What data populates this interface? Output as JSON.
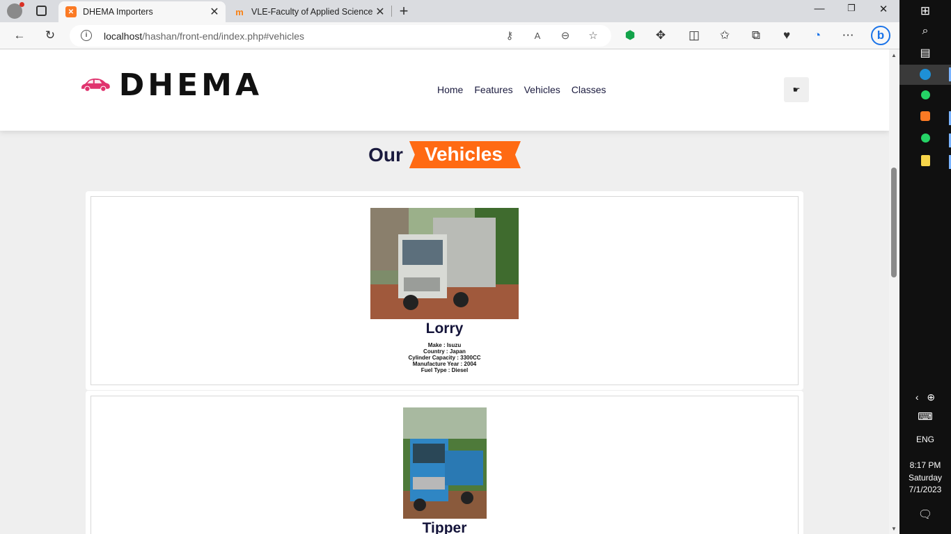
{
  "browser": {
    "tabs": [
      {
        "title": "DHEMA Importers",
        "favicon": "xampp-icon",
        "active": true
      },
      {
        "title": "VLE-Faculty of Applied Science: L",
        "favicon": "moodle-icon",
        "active": false
      }
    ],
    "url_host": "localhost",
    "url_path": "/hashan/front-end/index.php#vehicles"
  },
  "site": {
    "logo_text": "DHEMA",
    "nav": [
      "Home",
      "Features",
      "Vehicles",
      "Classes"
    ],
    "menu_icon": "☛"
  },
  "section": {
    "title_plain": "Our",
    "title_highlight": "Vehicles"
  },
  "vehicles": [
    {
      "name": "Lorry",
      "specs": [
        "Make : Isuzu",
        "Country : Japan",
        "Cylinder Capacity : 3300CC",
        "Manufacture Year : 2004",
        "Fuel Type : Diesel"
      ]
    },
    {
      "name": "Tipper",
      "specs": []
    }
  ],
  "taskbar": {
    "language": "ENG",
    "time": "8:17 PM",
    "day": "Saturday",
    "date": "7/1/2023"
  },
  "colors": {
    "accent": "#ff6a13",
    "navy": "#1a1a3e",
    "logo_car": "#e0336e"
  }
}
